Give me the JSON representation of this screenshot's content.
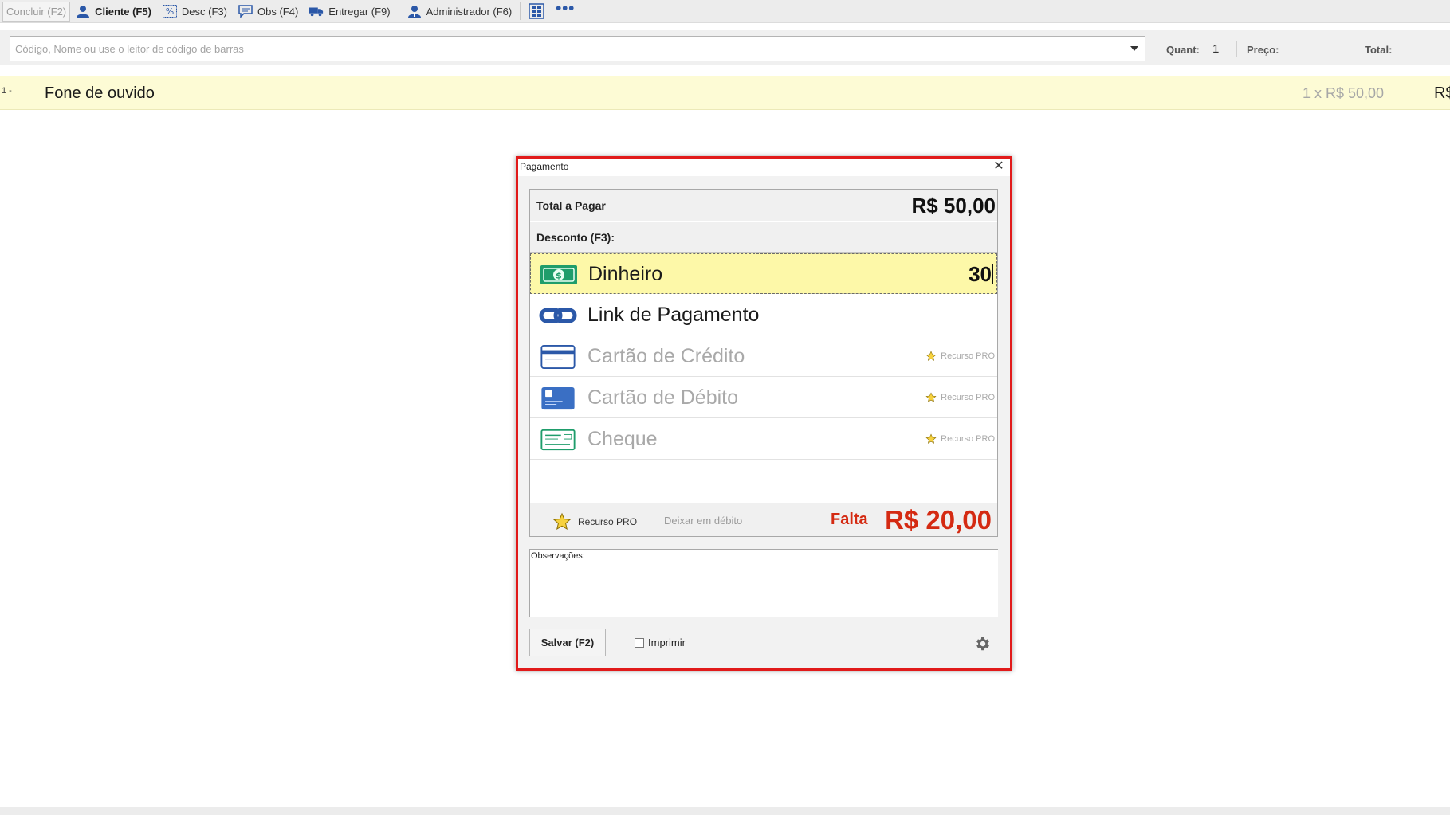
{
  "toolbar": {
    "concluir": "Concluir (F2)",
    "cliente": "Cliente (F5)",
    "desc": "Desc (F3)",
    "obs": "Obs (F4)",
    "entregar": "Entregar (F9)",
    "administrador": "Administrador (F6)",
    "more": "•••"
  },
  "search": {
    "placeholder": "Código, Nome ou use o leitor de código de barras",
    "value": "",
    "quant_label": "Quant:",
    "quant_value": "1",
    "preco_label": "Preço:",
    "total_label": "Total:"
  },
  "items": [
    {
      "index": "1 -",
      "name": "Fone de ouvido",
      "qty_price": "1  x  R$ 50,00",
      "total": "R$"
    }
  ],
  "dialog": {
    "title": "Pagamento",
    "close": "✕",
    "total_label": "Total a Pagar",
    "total_value": "R$ 50,00",
    "discount_label": "Desconto (F3):",
    "methods": [
      {
        "label": "Dinheiro",
        "value": "30",
        "icon": "cash-icon",
        "state": "active"
      },
      {
        "label": "Link de Pagamento",
        "value": "",
        "icon": "link-icon",
        "state": "enabled"
      },
      {
        "label": "Cartão de Crédito",
        "value": "",
        "icon": "credit-card-icon",
        "state": "disabled",
        "badge": "Recurso PRO"
      },
      {
        "label": "Cartão de Débito",
        "value": "",
        "icon": "debit-card-icon",
        "state": "disabled",
        "badge": "Recurso PRO"
      },
      {
        "label": "Cheque",
        "value": "",
        "icon": "cheque-icon",
        "state": "disabled",
        "badge": "Recurso PRO"
      }
    ],
    "footer_pro": "Recurso PRO",
    "footer_debit": "Deixar em débito",
    "falta_label": "Falta",
    "falta_value": "R$ 20,00",
    "obs_label": "Observações:",
    "save_label": "Salvar (F2)",
    "print_label": "Imprimir",
    "print_checked": false
  },
  "colors": {
    "dialog_border": "#e11a1a",
    "active_row": "#fdf8a8",
    "item_row": "#fdfbd5",
    "falta": "#d42a12",
    "icon_blue": "#2b58a8",
    "cash_green": "#1f9d6b"
  }
}
